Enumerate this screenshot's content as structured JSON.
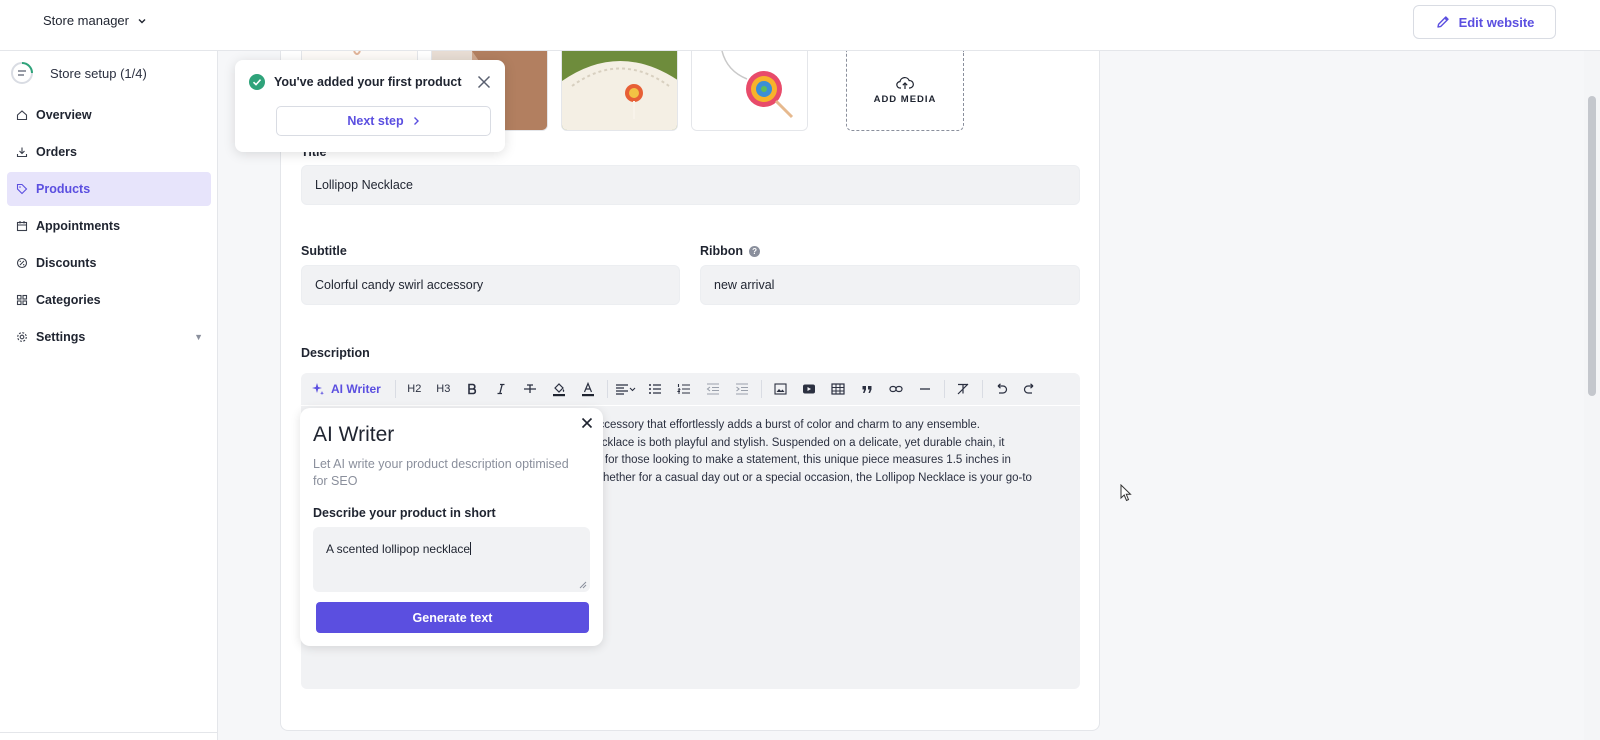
{
  "header": {
    "store_switcher_label": "Store manager",
    "edit_website_label": "Edit website"
  },
  "sidebar": {
    "setup_label": "Store setup (1/4)",
    "items": [
      {
        "label": "Overview",
        "icon": "home-icon"
      },
      {
        "label": "Orders",
        "icon": "download-icon"
      },
      {
        "label": "Products",
        "icon": "tag-icon",
        "active": true
      },
      {
        "label": "Appointments",
        "icon": "calendar-icon"
      },
      {
        "label": "Discounts",
        "icon": "discount-icon"
      },
      {
        "label": "Categories",
        "icon": "grid-icon"
      },
      {
        "label": "Settings",
        "icon": "gear-icon"
      }
    ]
  },
  "toast": {
    "message": "You've added your first product",
    "next_step_label": "Next step"
  },
  "media": {
    "add_media_label": "ADD MEDIA"
  },
  "form": {
    "title_label": "Title",
    "title_value": "Lollipop Necklace",
    "subtitle_label": "Subtitle",
    "subtitle_value": "Colorful candy swirl accessory",
    "ribbon_label": "Ribbon",
    "ribbon_value": "new arrival",
    "description_label": "Description",
    "description_text": "ul accessory that effortlessly adds a burst of color and charm to any ensemble.\ns necklace is both playful and stylish. Suspended on a delicate, yet durable chain, it\ndeal for those looking to make a statement, this unique piece measures 1.5 inches in\ns. Whether for a casual day out or a special occasion, the Lollipop Necklace is your go-to"
  },
  "toolbar": {
    "ai_writer_label": "AI Writer",
    "h2": "H2",
    "h3": "H3"
  },
  "ai_writer": {
    "title": "AI Writer",
    "description": "Let AI write your product description optimised for SEO",
    "prompt_label": "Describe your product in short",
    "prompt_value": "A scented lollipop necklace",
    "generate_label": "Generate text"
  },
  "colors": {
    "accent": "#5b4fe0",
    "active_bg": "#e7e4fb",
    "success": "#2fa37a"
  }
}
